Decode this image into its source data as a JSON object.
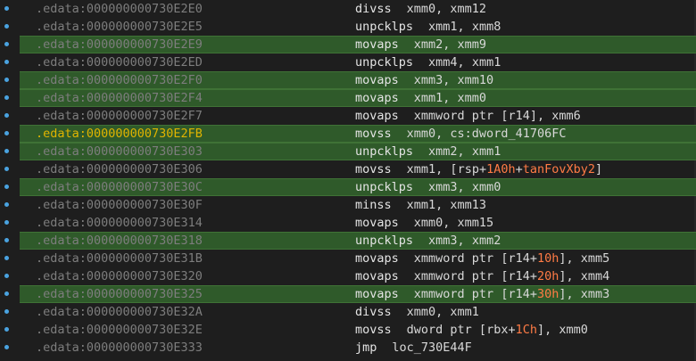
{
  "accent_colors": {
    "highlight_row": "#2f5a2a",
    "current_address": "#e0b400",
    "address": "#7d7d7d",
    "numeric_operand": "#ff7b45",
    "breakpoint_dot": "#4aa3e0"
  },
  "rows": [
    {
      "addr": ".edata:000000000730E2E0",
      "mnem": "divss",
      "ops": [
        {
          "t": "xmm0",
          "k": "reg"
        },
        {
          "t": ", ",
          "k": "punc"
        },
        {
          "t": "xmm12",
          "k": "reg"
        }
      ],
      "hl": false,
      "current": false
    },
    {
      "addr": ".edata:000000000730E2E5",
      "mnem": "unpcklps",
      "ops": [
        {
          "t": "xmm1",
          "k": "reg"
        },
        {
          "t": ", ",
          "k": "punc"
        },
        {
          "t": "xmm8",
          "k": "reg"
        }
      ],
      "hl": false,
      "current": false
    },
    {
      "addr": ".edata:000000000730E2E9",
      "mnem": "movaps",
      "ops": [
        {
          "t": "xmm2",
          "k": "reg"
        },
        {
          "t": ", ",
          "k": "punc"
        },
        {
          "t": "xmm9",
          "k": "reg"
        }
      ],
      "hl": true,
      "current": false
    },
    {
      "addr": ".edata:000000000730E2ED",
      "mnem": "unpcklps",
      "ops": [
        {
          "t": "xmm4",
          "k": "reg"
        },
        {
          "t": ", ",
          "k": "punc"
        },
        {
          "t": "xmm1",
          "k": "reg"
        }
      ],
      "hl": false,
      "current": false
    },
    {
      "addr": ".edata:000000000730E2F0",
      "mnem": "movaps",
      "ops": [
        {
          "t": "xmm3",
          "k": "reg"
        },
        {
          "t": ", ",
          "k": "punc"
        },
        {
          "t": "xmm10",
          "k": "reg"
        }
      ],
      "hl": true,
      "current": false
    },
    {
      "addr": ".edata:000000000730E2F4",
      "mnem": "movaps",
      "ops": [
        {
          "t": "xmm1",
          "k": "reg"
        },
        {
          "t": ", ",
          "k": "punc"
        },
        {
          "t": "xmm0",
          "k": "reg"
        }
      ],
      "hl": true,
      "current": false
    },
    {
      "addr": ".edata:000000000730E2F7",
      "mnem": "movaps",
      "ops": [
        {
          "t": "xmmword ptr ",
          "k": "kw"
        },
        {
          "t": "[",
          "k": "punc"
        },
        {
          "t": "r14",
          "k": "reg"
        },
        {
          "t": "]",
          "k": "punc"
        },
        {
          "t": ", ",
          "k": "punc"
        },
        {
          "t": "xmm6",
          "k": "reg"
        }
      ],
      "hl": false,
      "current": false
    },
    {
      "addr": ".edata:000000000730E2FB",
      "mnem": "movss",
      "ops": [
        {
          "t": "xmm0",
          "k": "reg"
        },
        {
          "t": ", ",
          "k": "punc"
        },
        {
          "t": "cs:dword_41706FC",
          "k": "reg"
        }
      ],
      "hl": true,
      "current": true
    },
    {
      "addr": ".edata:000000000730E303",
      "mnem": "unpcklps",
      "ops": [
        {
          "t": "xmm2",
          "k": "reg"
        },
        {
          "t": ", ",
          "k": "punc"
        },
        {
          "t": "xmm1",
          "k": "reg"
        }
      ],
      "hl": true,
      "current": false
    },
    {
      "addr": ".edata:000000000730E306",
      "mnem": "movss",
      "ops": [
        {
          "t": "xmm1",
          "k": "reg"
        },
        {
          "t": ", ",
          "k": "punc"
        },
        {
          "t": "[",
          "k": "punc"
        },
        {
          "t": "rsp",
          "k": "reg"
        },
        {
          "t": "+",
          "k": "punc"
        },
        {
          "t": "1A0h",
          "k": "num"
        },
        {
          "t": "+",
          "k": "punc"
        },
        {
          "t": "tanFovXby2",
          "k": "sym"
        },
        {
          "t": "]",
          "k": "punc"
        }
      ],
      "hl": false,
      "current": false
    },
    {
      "addr": ".edata:000000000730E30C",
      "mnem": "unpcklps",
      "ops": [
        {
          "t": "xmm3",
          "k": "reg"
        },
        {
          "t": ", ",
          "k": "punc"
        },
        {
          "t": "xmm0",
          "k": "reg"
        }
      ],
      "hl": true,
      "current": false
    },
    {
      "addr": ".edata:000000000730E30F",
      "mnem": "minss",
      "ops": [
        {
          "t": "xmm1",
          "k": "reg"
        },
        {
          "t": ", ",
          "k": "punc"
        },
        {
          "t": "xmm13",
          "k": "reg"
        }
      ],
      "hl": false,
      "current": false
    },
    {
      "addr": ".edata:000000000730E314",
      "mnem": "movaps",
      "ops": [
        {
          "t": "xmm0",
          "k": "reg"
        },
        {
          "t": ", ",
          "k": "punc"
        },
        {
          "t": "xmm15",
          "k": "reg"
        }
      ],
      "hl": false,
      "current": false
    },
    {
      "addr": ".edata:000000000730E318",
      "mnem": "unpcklps",
      "ops": [
        {
          "t": "xmm3",
          "k": "reg"
        },
        {
          "t": ", ",
          "k": "punc"
        },
        {
          "t": "xmm2",
          "k": "reg"
        }
      ],
      "hl": true,
      "current": false
    },
    {
      "addr": ".edata:000000000730E31B",
      "mnem": "movaps",
      "ops": [
        {
          "t": "xmmword ptr ",
          "k": "kw"
        },
        {
          "t": "[",
          "k": "punc"
        },
        {
          "t": "r14",
          "k": "reg"
        },
        {
          "t": "+",
          "k": "punc"
        },
        {
          "t": "10h",
          "k": "num"
        },
        {
          "t": "]",
          "k": "punc"
        },
        {
          "t": ", ",
          "k": "punc"
        },
        {
          "t": "xmm5",
          "k": "reg"
        }
      ],
      "hl": false,
      "current": false
    },
    {
      "addr": ".edata:000000000730E320",
      "mnem": "movaps",
      "ops": [
        {
          "t": "xmmword ptr ",
          "k": "kw"
        },
        {
          "t": "[",
          "k": "punc"
        },
        {
          "t": "r14",
          "k": "reg"
        },
        {
          "t": "+",
          "k": "punc"
        },
        {
          "t": "20h",
          "k": "num"
        },
        {
          "t": "]",
          "k": "punc"
        },
        {
          "t": ", ",
          "k": "punc"
        },
        {
          "t": "xmm4",
          "k": "reg"
        }
      ],
      "hl": false,
      "current": false
    },
    {
      "addr": ".edata:000000000730E325",
      "mnem": "movaps",
      "ops": [
        {
          "t": "xmmword ptr ",
          "k": "kw"
        },
        {
          "t": "[",
          "k": "punc"
        },
        {
          "t": "r14",
          "k": "reg"
        },
        {
          "t": "+",
          "k": "punc"
        },
        {
          "t": "30h",
          "k": "num"
        },
        {
          "t": "]",
          "k": "punc"
        },
        {
          "t": ", ",
          "k": "punc"
        },
        {
          "t": "xmm3",
          "k": "reg"
        }
      ],
      "hl": true,
      "current": false
    },
    {
      "addr": ".edata:000000000730E32A",
      "mnem": "divss",
      "ops": [
        {
          "t": "xmm0",
          "k": "reg"
        },
        {
          "t": ", ",
          "k": "punc"
        },
        {
          "t": "xmm1",
          "k": "reg"
        }
      ],
      "hl": false,
      "current": false
    },
    {
      "addr": ".edata:000000000730E32E",
      "mnem": "movss",
      "ops": [
        {
          "t": "dword ptr ",
          "k": "kw"
        },
        {
          "t": "[",
          "k": "punc"
        },
        {
          "t": "rbx",
          "k": "reg"
        },
        {
          "t": "+",
          "k": "punc"
        },
        {
          "t": "1Ch",
          "k": "num"
        },
        {
          "t": "]",
          "k": "punc"
        },
        {
          "t": ", ",
          "k": "punc"
        },
        {
          "t": "xmm0",
          "k": "reg"
        }
      ],
      "hl": false,
      "current": false
    },
    {
      "addr": ".edata:000000000730E333",
      "mnem": "jmp",
      "ops": [
        {
          "t": "loc_730E44F",
          "k": "reg"
        }
      ],
      "hl": false,
      "current": false
    }
  ]
}
